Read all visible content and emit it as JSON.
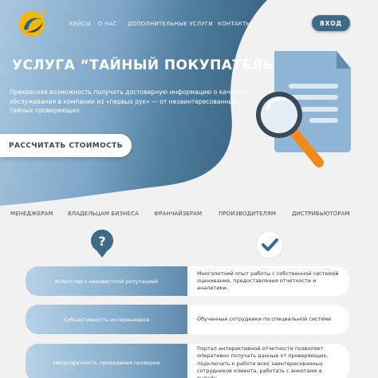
{
  "nav": {
    "items": [
      {
        "label": "КЕЙСЫ"
      },
      {
        "label": "О НАС"
      },
      {
        "label": "ДОПОЛНИТЕЛЬНЫЕ УСЛУГИ"
      },
      {
        "label": "КОНТАКТЫ"
      }
    ],
    "login_label": "ВХОД"
  },
  "hero": {
    "title": "УСЛУГА “ТАЙНЫЙ ПОКУПАТЕЛЬ”",
    "description": "Прекрасная возможность получить достоверную информацию о качестве обслуживания в компании из «первых рук» — от незаинтересованных тайных проверяющих.",
    "cta_label": "РАССЧИТАТЬ СТОИМОСТЬ"
  },
  "audiences": [
    {
      "label": "МЕНЕДЖЕРАМ"
    },
    {
      "label": "ВЛАДЕЛЬЦАМ БИЗНЕСА"
    },
    {
      "label": "ФРАНЧАЙЗЕРАМ"
    },
    {
      "label": "ПРОИЗВОДИТЕЛЯМ"
    },
    {
      "label": "ДИСТРИБЬЮТОРАМ"
    }
  ],
  "comparison": {
    "rows": [
      {
        "problem": "Агентства с неизвестной репутацией",
        "solution": "Многолетний опыт работы с собственной системой оценивания, предоставления отчетности и аналитики."
      },
      {
        "problem": "Субъективность интервьюеров",
        "solution": "Обученные сотрудники по специальной системе"
      },
      {
        "problem": "Непрозрачность проведения проверки",
        "solution": "Портал интерактивной отчетности позволяет оперативно получать данные от проверяющих, подключать к работе всех заинтересованных сотрудников клиента, работать с анкетами в онлайн"
      }
    ]
  },
  "colors": {
    "hero_light": "#9fc1dc",
    "hero_dark": "#3e6a8a",
    "accent_orange": "#f08a1c",
    "logo_yellow": "#f5b800"
  }
}
